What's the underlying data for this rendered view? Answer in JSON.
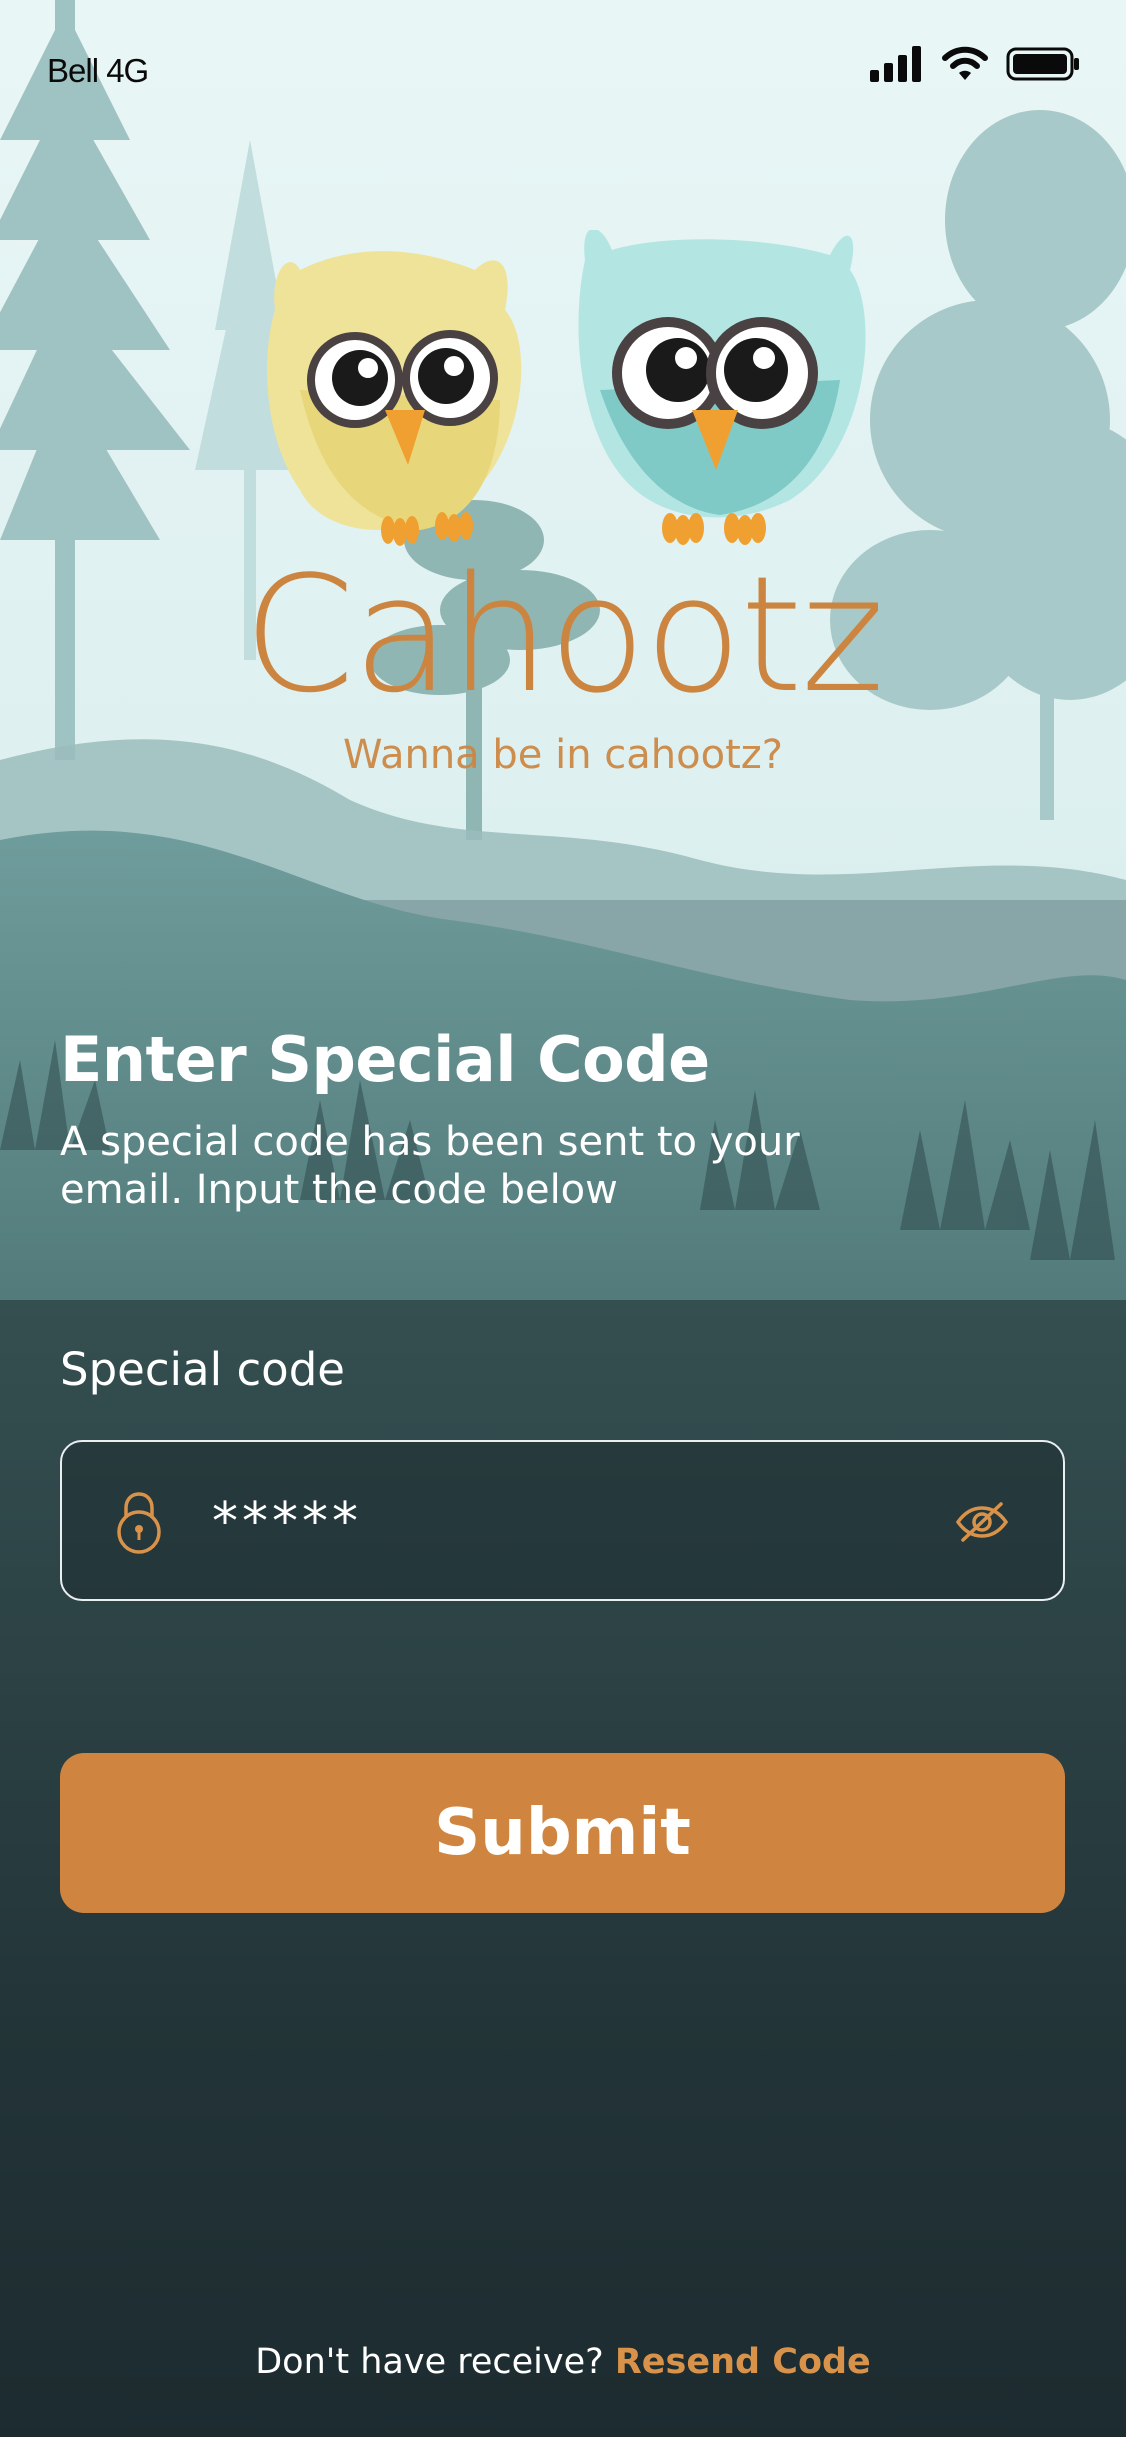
{
  "status_bar": {
    "carrier": "Bell 4G",
    "icons": [
      "signal-icon",
      "wifi-icon",
      "battery-icon"
    ]
  },
  "brand": {
    "name": "Cahootz",
    "tagline": "Wanna be in cahootz?",
    "mascots": [
      "yellow-owl",
      "teal-owl"
    ]
  },
  "verification": {
    "title": "Enter Special Code",
    "subtitle": "A special code has been sent to your email. Input the code below",
    "field_label": "Special code",
    "field_value": "*****",
    "field_icon": "lock-icon",
    "toggle_icon": "eye-slash-icon"
  },
  "actions": {
    "submit_label": "Submit"
  },
  "footer": {
    "prompt": "Don't have receive?",
    "resend_label": "Resend Code"
  },
  "colors": {
    "accent": "#cf8540",
    "background_dark": "#1d2c30",
    "sky": "#e6f4f4",
    "text": "#ffffff"
  }
}
